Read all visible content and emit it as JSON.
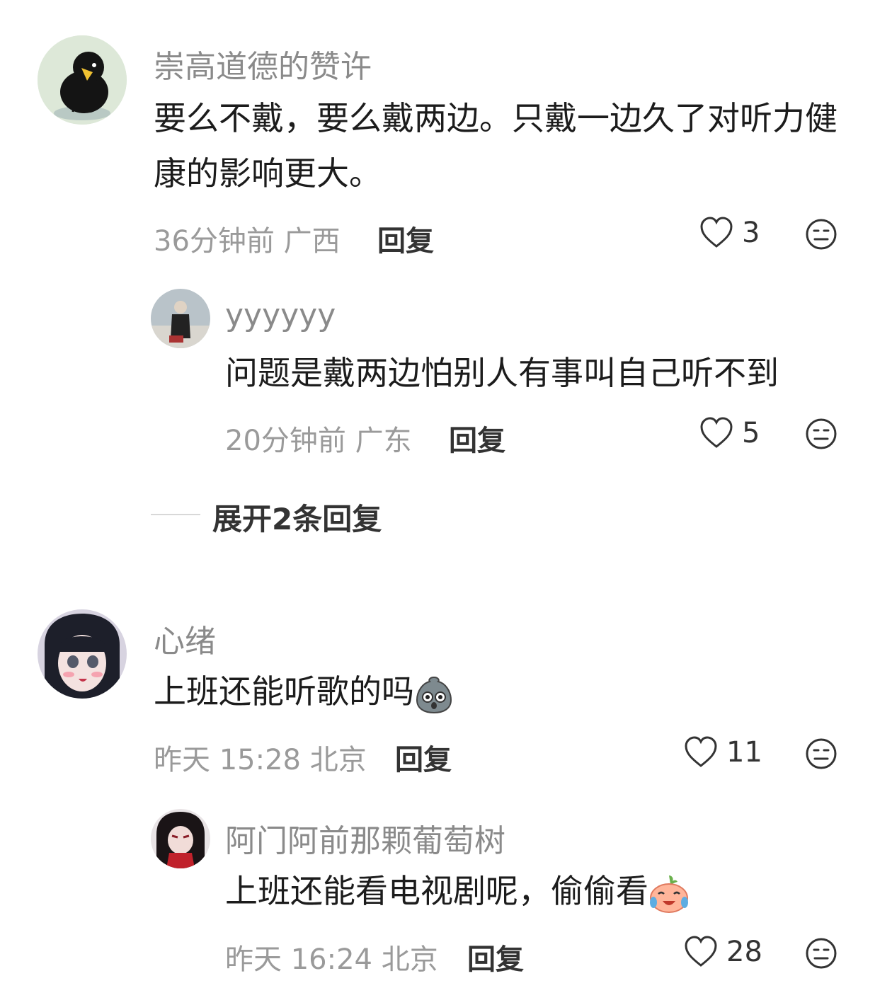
{
  "comments": [
    {
      "username": "崇高道德的赞许",
      "text": "要么不戴，要么戴两边。只戴一边久了对听力健康的影响更大。",
      "time": "36分钟前 广西",
      "reply_label": "回复",
      "likes": "3",
      "avatar": "black-bird-avatar"
    },
    {
      "username": "yyyyyy",
      "text": "问题是戴两边怕别人有事叫自己听不到",
      "time": "20分钟前 广东",
      "reply_label": "回复",
      "likes": "5",
      "avatar": "man-in-coat-avatar"
    },
    {
      "username": "心绪",
      "text": "上班还能听歌的吗",
      "emoji": "shocked-potato-emoji",
      "time": "昨天 15:28 北京",
      "reply_label": "回复",
      "likes": "11",
      "avatar": "anime-girl-avatar"
    },
    {
      "username": "阿门阿前那颗葡萄树",
      "text": "上班还能看电视剧呢，偷偷看",
      "emoji": "crying-laughing-peach-emoji",
      "time": "昨天 16:24 北京",
      "reply_label": "回复",
      "likes": "28",
      "avatar": "dark-anime-avatar"
    }
  ],
  "expand_replies": "展开2条回复",
  "colors": {
    "username": "#8a8a8a",
    "meta": "#9a9a9a",
    "text": "#1c1c1c"
  }
}
